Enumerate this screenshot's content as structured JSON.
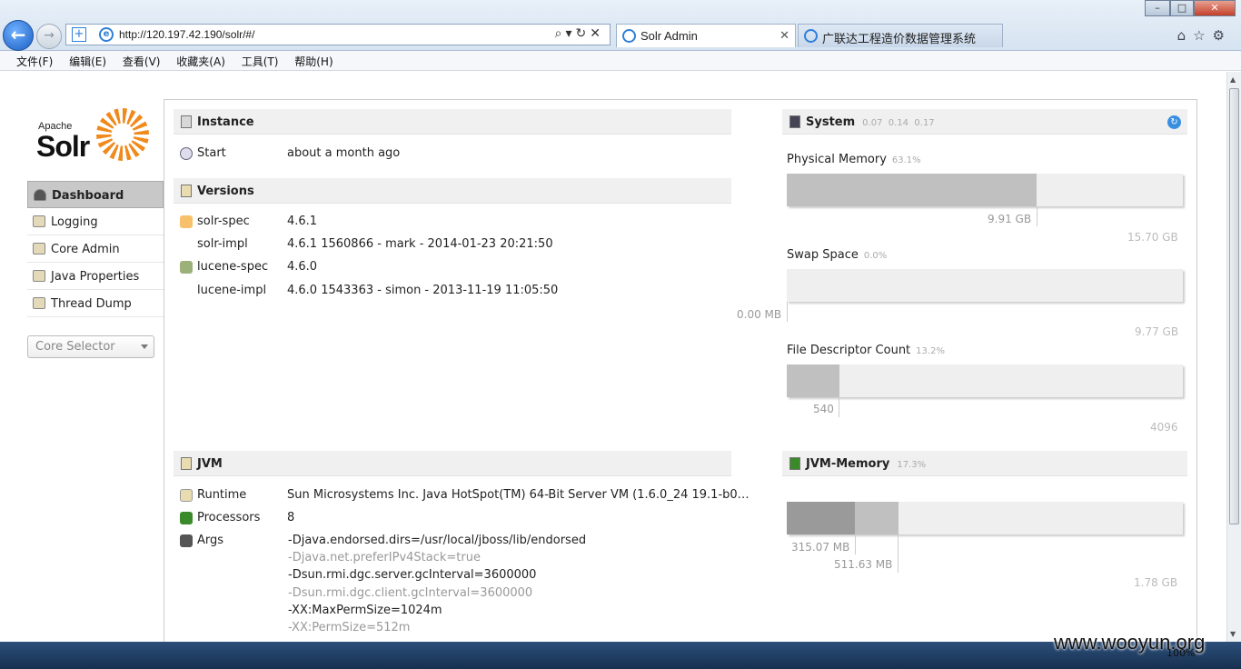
{
  "browser": {
    "url": "http://120.197.42.190/solr/#/",
    "tabs": [
      {
        "title": "Solr Admin",
        "active": true
      },
      {
        "title": "广联达工程造价数据管理系统",
        "active": false
      }
    ],
    "menu": [
      "文件(F)",
      "编辑(E)",
      "查看(V)",
      "收藏夹(A)",
      "工具(T)",
      "帮助(H)"
    ],
    "zoom": "100%"
  },
  "logo": {
    "apache": "Apache",
    "solr": "Solr"
  },
  "sidebar": {
    "items": [
      {
        "label": "Dashboard",
        "icon": "dashboard-icon",
        "active": true
      },
      {
        "label": "Logging",
        "icon": "logging-icon"
      },
      {
        "label": "Core Admin",
        "icon": "core-admin-icon"
      },
      {
        "label": "Java Properties",
        "icon": "java-properties-icon"
      },
      {
        "label": "Thread Dump",
        "icon": "thread-dump-icon"
      }
    ],
    "core_selector": "Core Selector"
  },
  "instance": {
    "title": "Instance",
    "start_label": "Start",
    "start_value": "about a month ago"
  },
  "versions": {
    "title": "Versions",
    "rows": [
      {
        "label": "solr-spec",
        "value": "4.6.1"
      },
      {
        "label": "solr-impl",
        "value": "4.6.1 1560866 - mark - 2014-01-23 20:21:50"
      },
      {
        "label": "lucene-spec",
        "value": "4.6.0"
      },
      {
        "label": "lucene-impl",
        "value": "4.6.0 1543363 - simon - 2013-11-19 11:05:50"
      }
    ]
  },
  "jvm": {
    "title": "JVM",
    "runtime_label": "Runtime",
    "runtime_value": "Sun Microsystems Inc. Java HotSpot(TM) 64-Bit Server VM (1.6.0_24 19.1-b0…",
    "processors_label": "Processors",
    "processors_value": "8",
    "args_label": "Args",
    "args": [
      "-Djava.endorsed.dirs=/usr/local/jboss/lib/endorsed",
      "-Djava.net.preferIPv4Stack=true",
      "-Dsun.rmi.dgc.server.gcInterval=3600000",
      "-Dsun.rmi.dgc.client.gcInterval=3600000",
      "-XX:MaxPermSize=1024m",
      "-XX:PermSize=512m"
    ]
  },
  "system": {
    "title": "System",
    "load": [
      "0.07",
      "0.14",
      "0.17"
    ],
    "physical_memory": {
      "title": "Physical Memory",
      "pct": "63.1%",
      "used": "9.91 GB",
      "total": "15.70 GB",
      "fraction": 0.631
    },
    "swap_space": {
      "title": "Swap Space",
      "pct": "0.0%",
      "used": "0.00 MB",
      "total": "9.77 GB",
      "fraction": 0.0
    },
    "file_descriptor": {
      "title": "File Descriptor Count",
      "pct": "13.2%",
      "used": "540",
      "total": "4096",
      "fraction": 0.132
    }
  },
  "jvm_memory": {
    "title": "JVM-Memory",
    "pct": "17.3%",
    "used": "315.07 MB",
    "committed": "511.63 MB",
    "max": "1.78 GB",
    "used_fraction": 0.173,
    "committed_fraction": 0.281
  },
  "watermark": "www.wooyun.org"
}
